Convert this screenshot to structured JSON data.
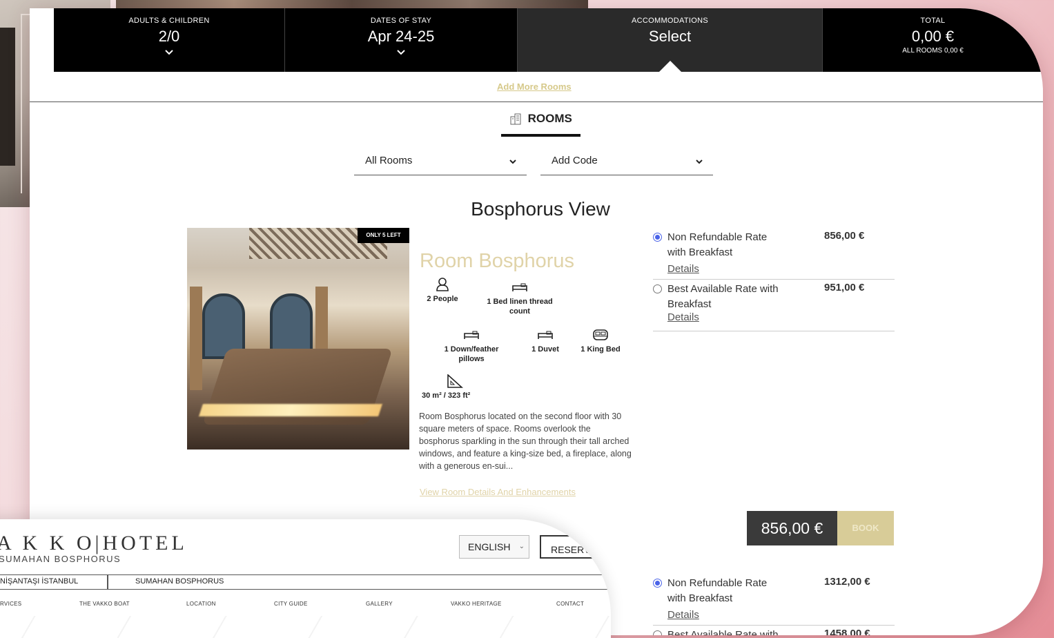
{
  "booking_bar": {
    "guests_label": "ADULTS & CHILDREN",
    "guests_value": "2/0",
    "dates_label": "DATES OF STAY",
    "dates_value": "Apr 24-25",
    "accom_label": "ACCOMMODATIONS",
    "accom_value": "Select",
    "total_label": "TOTAL",
    "total_value": "0,00 €",
    "total_sub": "ALL ROOMS 0,00 €"
  },
  "add_more_rooms": "Add More Rooms",
  "rooms_tab": "ROOMS",
  "filters": {
    "rooms_select": "All Rooms",
    "code_select": "Add Code"
  },
  "room": {
    "category_title": "Bosphorus View",
    "badge": "ONLY 5 LEFT",
    "name": "Room Bosphorus",
    "amenities": {
      "people": "2 People",
      "linen": "1 Bed linen thread count",
      "pillows": "1 Down/feather pillows",
      "duvet": "1 Duvet",
      "king": "1 King Bed",
      "size": "30 m² / 323 ft²"
    },
    "description": "Room Bosphorus located on the second floor with 30 square meters of space. Rooms overlook the bosphorus sparkling in the sun through their tall arched windows, and feature a king-size bed, a fireplace, along with a generous en-sui...",
    "view_details": "View Room Details And Enhancements"
  },
  "rates": [
    {
      "name": "Non Refundable Rate with Breakfast",
      "price": "856,00 €",
      "details": "Details",
      "selected": true
    },
    {
      "name": "Best Available Rate with Breakfast",
      "price": "951,00 €",
      "details": "Details",
      "selected": false
    },
    {
      "name": "Non Refundable Rate with Breakfast",
      "price": "1312,00 €",
      "details": "Details",
      "selected": true
    },
    {
      "name": "Best Available Rate with",
      "price": "1458,00 €",
      "details": "",
      "selected": false
    }
  ],
  "selected_price": "856,00 €",
  "book_label": "BOOK",
  "website": {
    "logo": "A K K O|HOTEL",
    "logo_sub": "SUMAHAN BOSPHORUS",
    "language": "ENGLISH",
    "reserve": "RESERV",
    "tab_a": "NİŞANTAŞI İSTANBUL",
    "tab_b": "SUMAHAN BOSPHORUS",
    "nav": [
      "RVICES",
      "THE VAKKO BOAT",
      "LOCATION",
      "CITY GUIDE",
      "GALLERY",
      "VAKKO HERITAGE",
      "CONTACT"
    ]
  },
  "colors": {
    "accent_gold": "#d8cc98",
    "bar_black": "#000000",
    "radio_blue": "#4a63e8",
    "bg_pink": "#e58d96"
  }
}
